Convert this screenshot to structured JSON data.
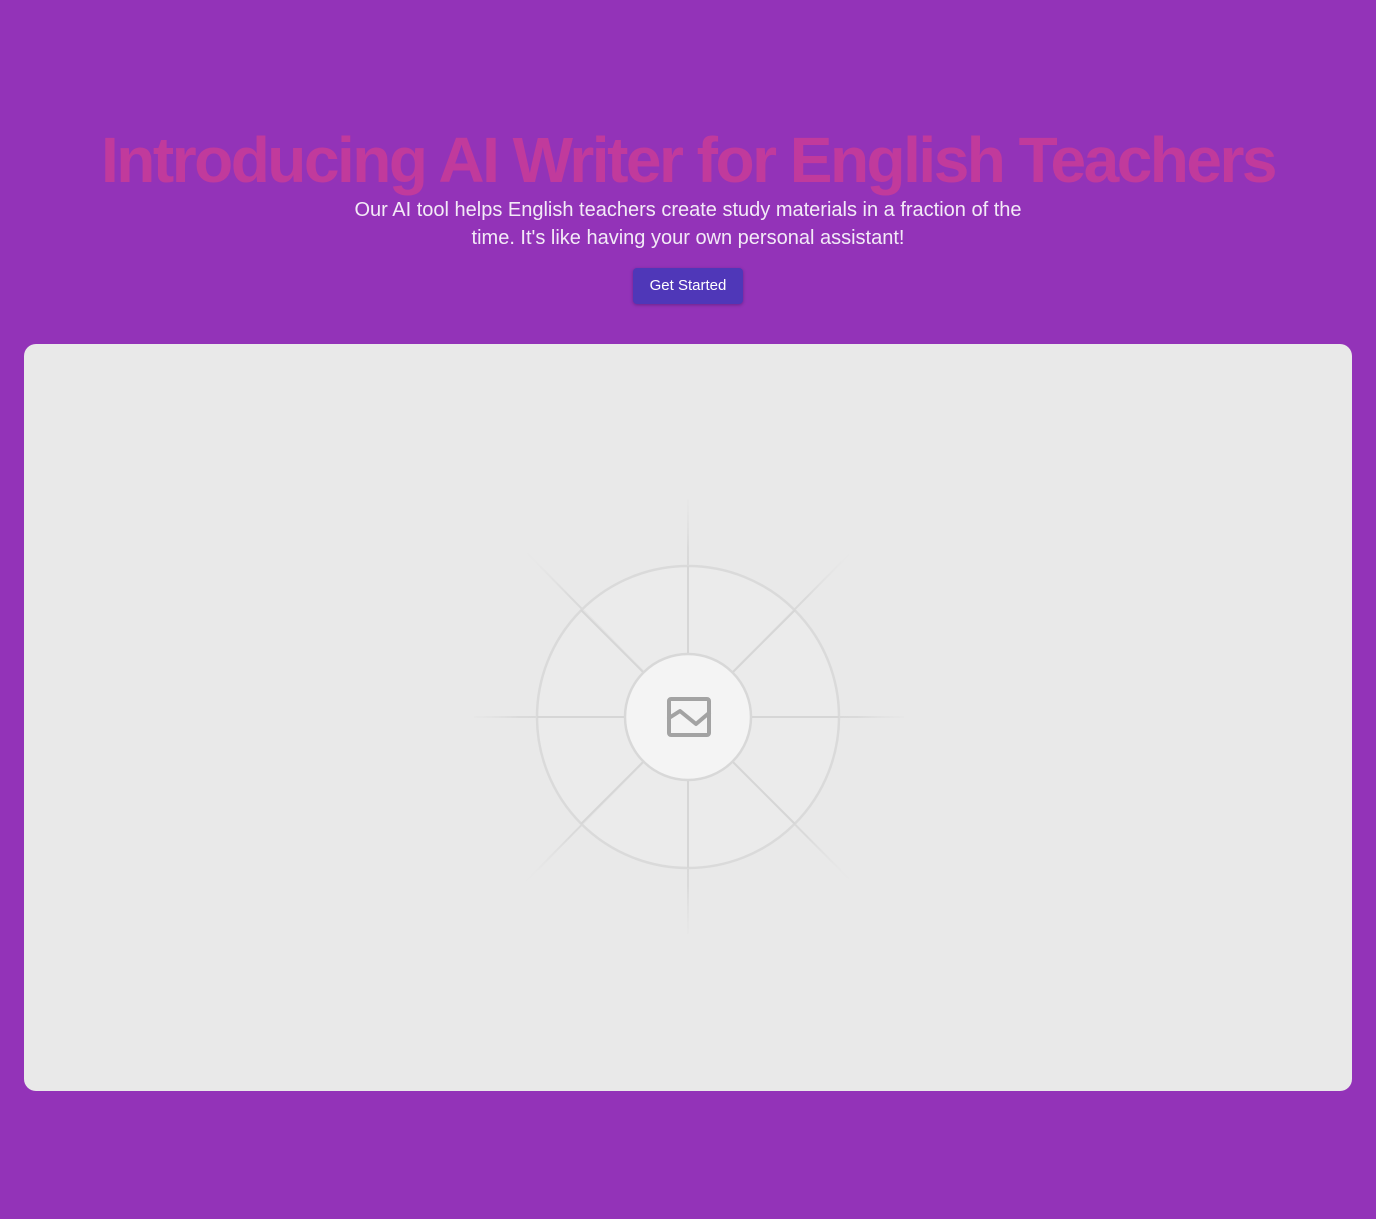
{
  "hero": {
    "title": "Introducing AI Writer for English Teachers",
    "subtitle": "Our AI tool helps English teachers create study materials in a fraction of the time. It's like having your own personal assistant!",
    "cta_label": "Get Started"
  },
  "image_placeholder": {
    "icon": "image-icon"
  },
  "colors": {
    "background": "#9333b8",
    "title": "#c13a9c",
    "subtitle": "#f3eaf7",
    "button": "#4f37b8",
    "panel": "#e9e9e9"
  }
}
